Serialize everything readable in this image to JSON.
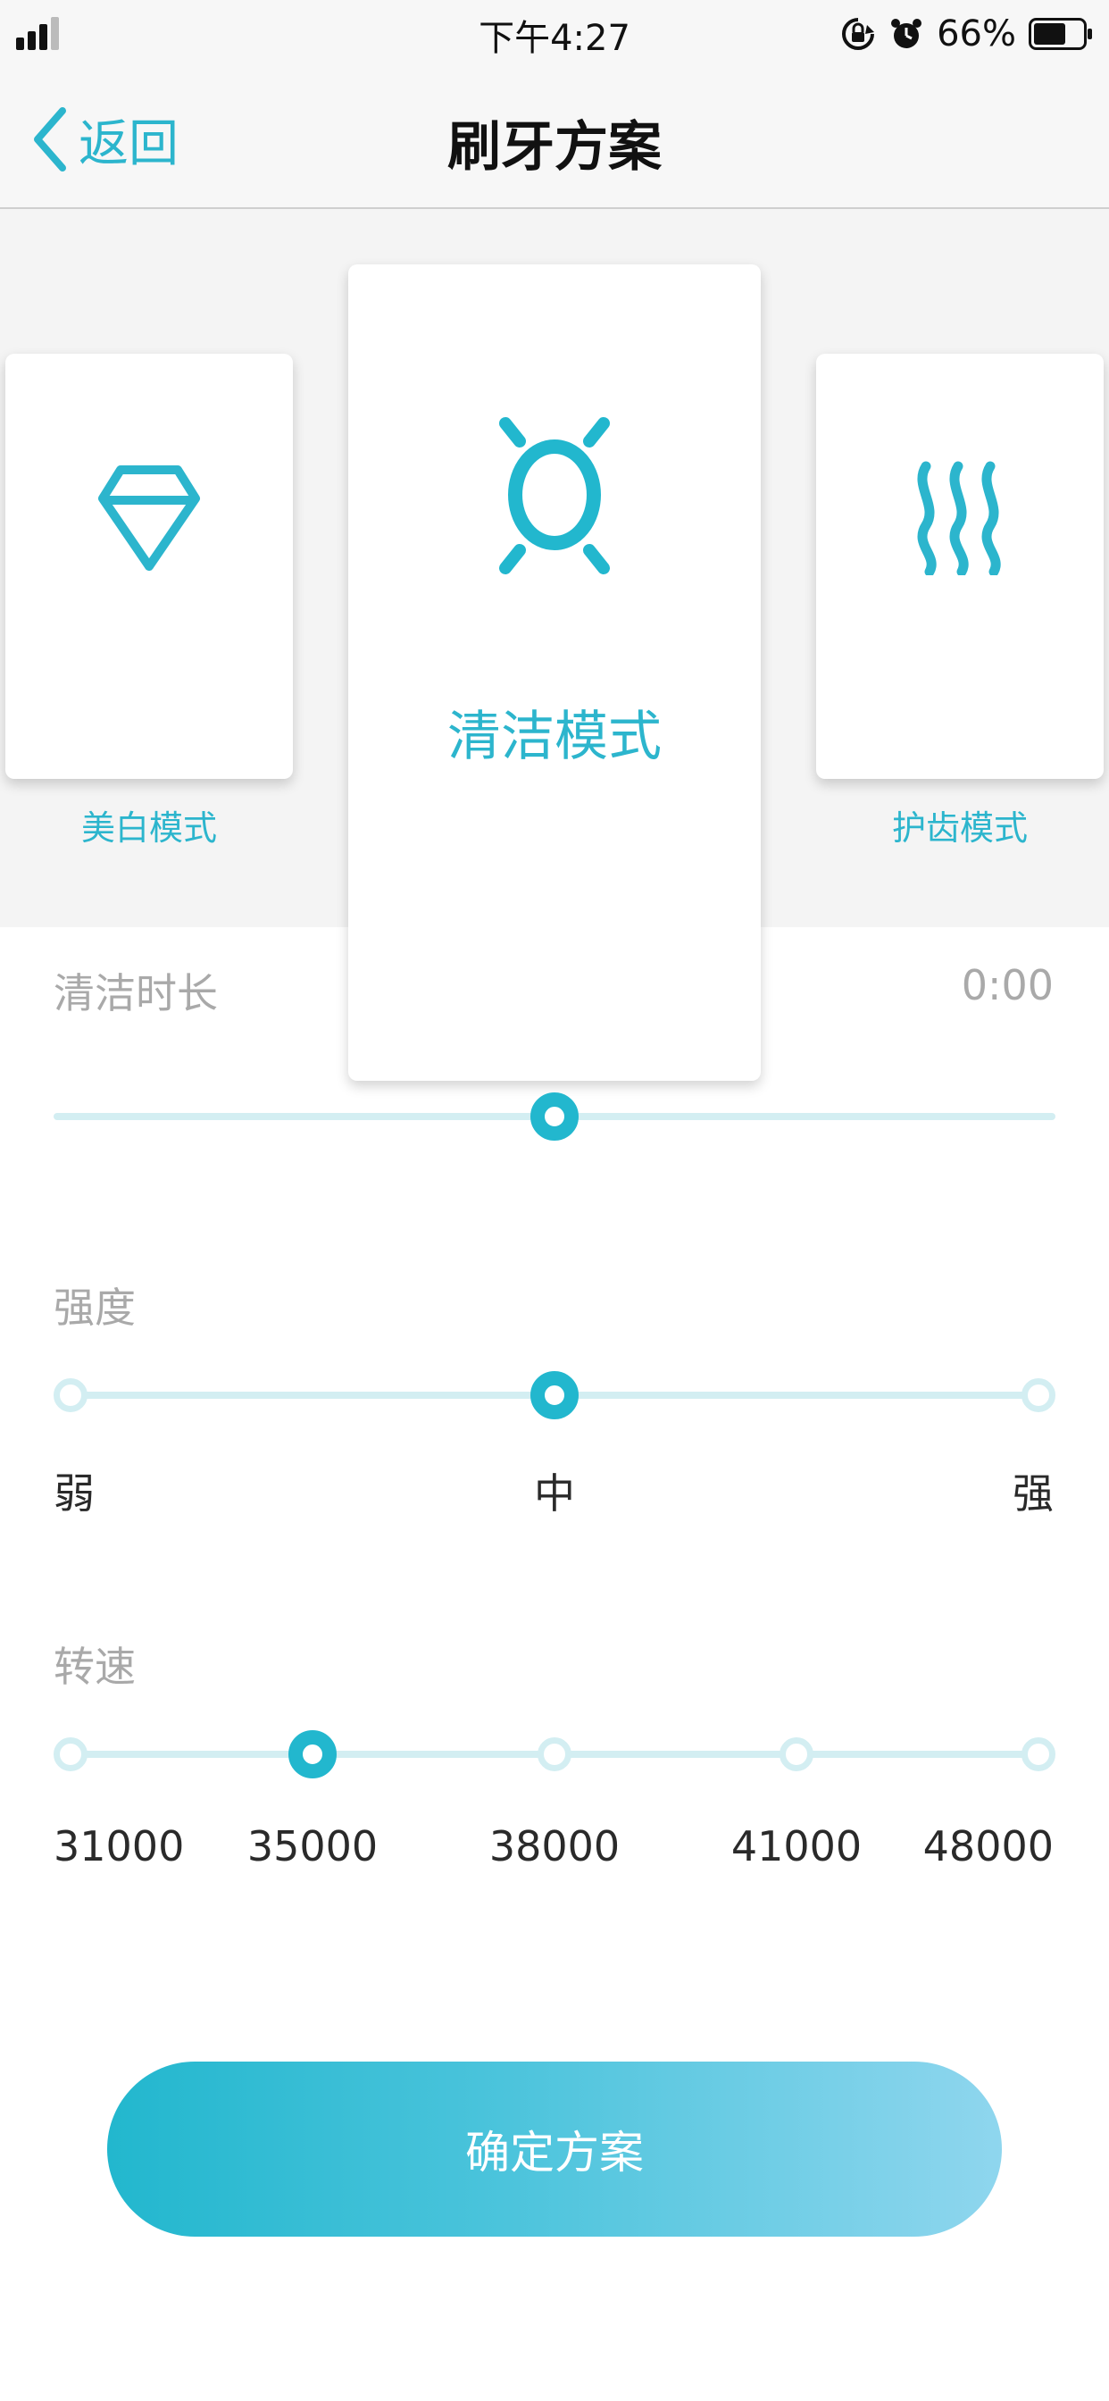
{
  "status_bar": {
    "time": "下午4:27",
    "battery_percent": "66%",
    "battery_level": 0.66,
    "icons": [
      "signal-icon",
      "orientation-lock-icon",
      "alarm-icon",
      "battery-icon"
    ]
  },
  "nav": {
    "back_label": "返回",
    "title": "刷牙方案"
  },
  "modes": [
    {
      "label": "美白模式",
      "icon": "diamond-icon",
      "selected": false
    },
    {
      "label": "清洁模式",
      "icon": "sun-icon",
      "selected": true
    },
    {
      "label": "护齿模式",
      "icon": "waves-icon",
      "selected": false
    }
  ],
  "duration": {
    "label": "清洁时长",
    "value": "0:00",
    "position": 0.5
  },
  "intensity": {
    "label": "强度",
    "options": [
      "弱",
      "中",
      "强"
    ],
    "selected_index": 1
  },
  "speed": {
    "label": "转速",
    "options": [
      "31000",
      "35000",
      "38000",
      "41000",
      "48000"
    ],
    "selected_index": 1
  },
  "confirm_label": "确定方案",
  "colors": {
    "accent": "#22b7ce",
    "track": "#d3eef2",
    "label_gray": "#a9a9a9",
    "gradient_end": "#8fd6ee"
  }
}
